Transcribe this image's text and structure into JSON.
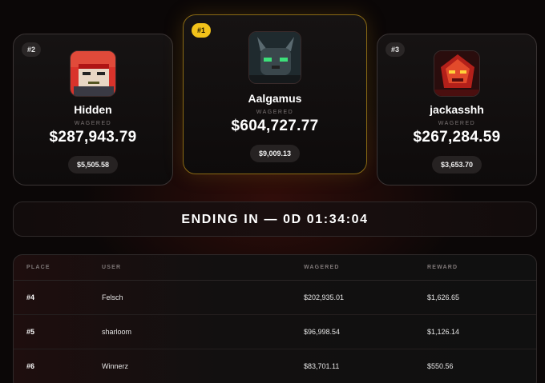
{
  "podium": [
    {
      "rank": "#2",
      "username": "Hidden",
      "wagered_label": "WAGERED",
      "wagered": "$287,943.79",
      "reward": "$5,505.58"
    },
    {
      "rank": "#1",
      "username": "Aalgamus",
      "wagered_label": "WAGERED",
      "wagered": "$604,727.77",
      "reward": "$9,009.13"
    },
    {
      "rank": "#3",
      "username": "jackasshh",
      "wagered_label": "WAGERED",
      "wagered": "$267,284.59",
      "reward": "$3,653.70"
    }
  ],
  "countdown": {
    "text": "ENDING IN — 0D 01:34:04"
  },
  "table": {
    "headers": [
      "PLACE",
      "USER",
      "WAGERED",
      "REWARD"
    ],
    "rows": [
      {
        "place": "#4",
        "user": "Felsch",
        "wagered": "$202,935.01",
        "reward": "$1,626.65"
      },
      {
        "place": "#5",
        "user": "sharloom",
        "wagered": "$96,998.54",
        "reward": "$1,126.14"
      },
      {
        "place": "#6",
        "user": "Winnerz",
        "wagered": "$83,701.11",
        "reward": "$550.56"
      }
    ]
  },
  "colors": {
    "gold": "#f2c21a",
    "background": "#0b0707"
  },
  "icons": [
    "avatar-red-fighter",
    "avatar-dark-cat",
    "avatar-red-mech"
  ]
}
